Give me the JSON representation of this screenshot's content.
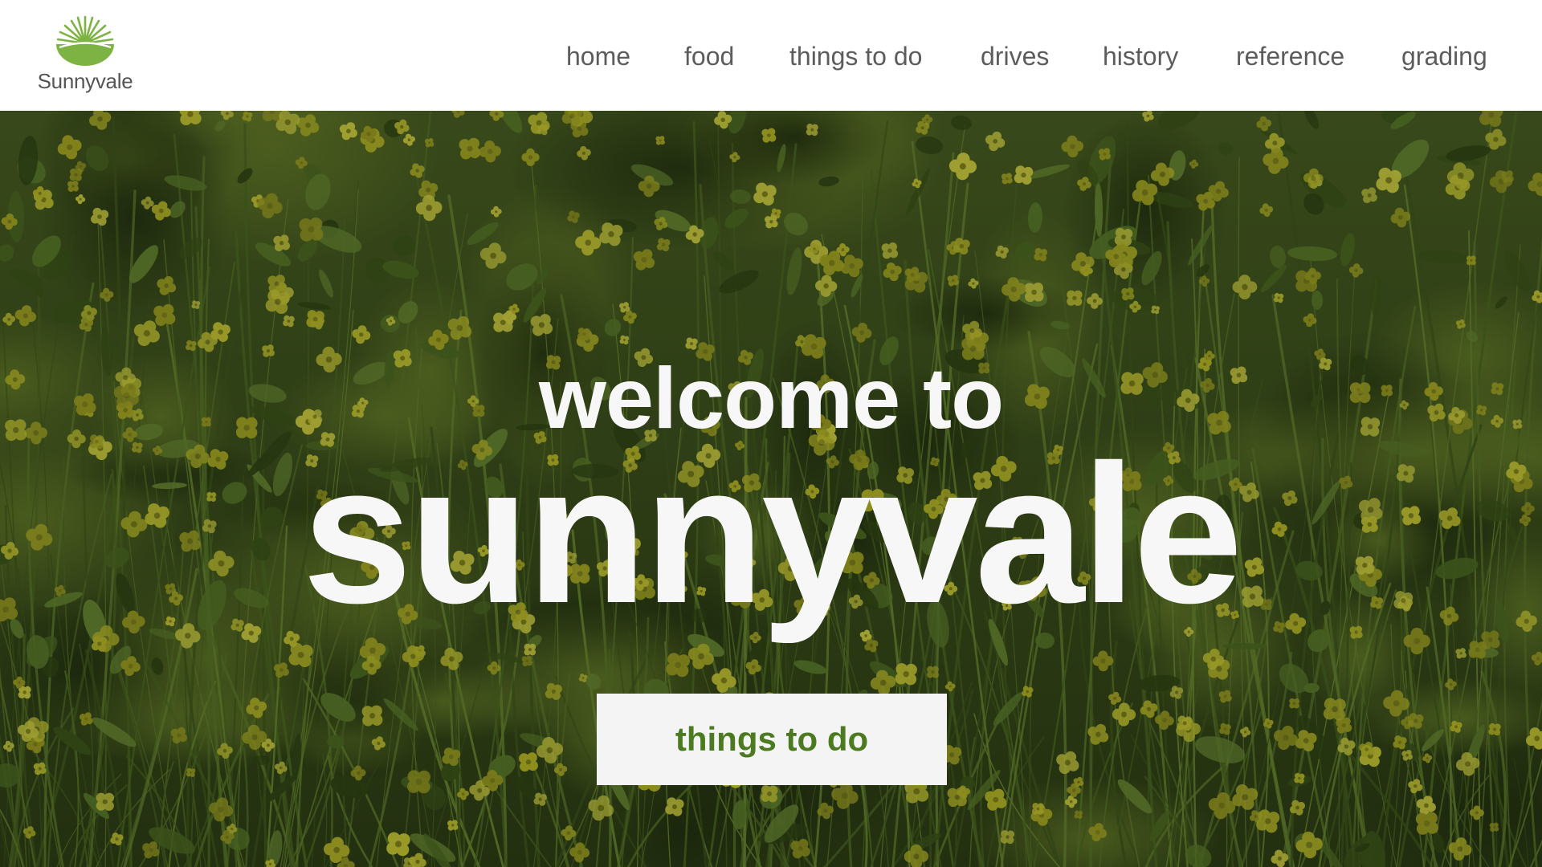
{
  "header": {
    "logo_text": "Sunnyvale",
    "logo_icon": "sunrise-logo-icon",
    "nav": {
      "home": "home",
      "food": "food",
      "things_to_do": "things to do",
      "drives": "drives",
      "history": "history",
      "reference": "reference",
      "grading": "grading"
    }
  },
  "hero": {
    "background": "yellow mustard flower field",
    "welcome": "welcome to",
    "title": "sunnyvale",
    "cta_label": "things to do"
  },
  "colors": {
    "brand_green": "#7cb342",
    "cta_text": "#4c7a21",
    "nav_text": "#5c5c5c",
    "hero_text": "#f7f7f7"
  }
}
